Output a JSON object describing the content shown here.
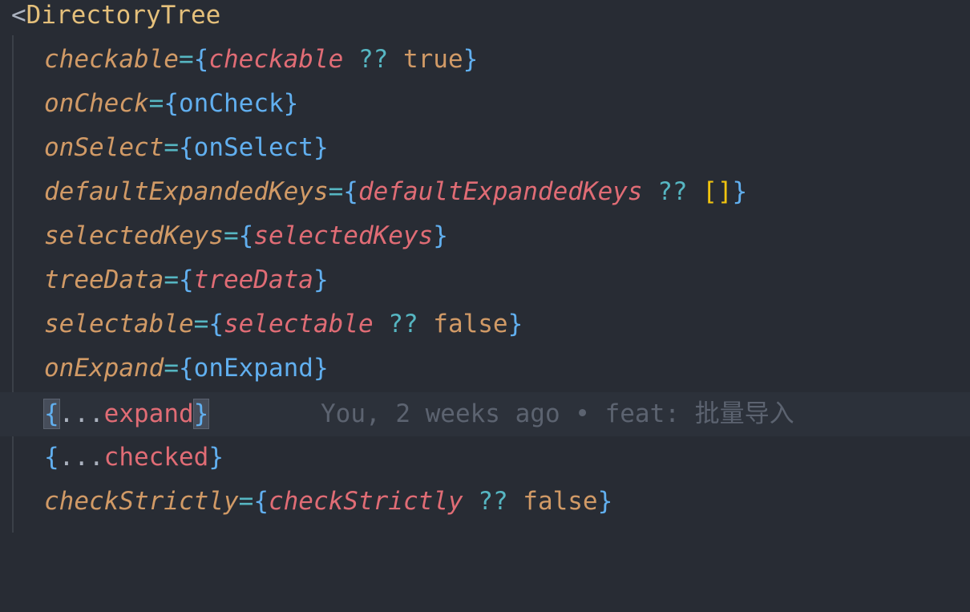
{
  "editor": {
    "lines": {
      "l0": {
        "open": "<",
        "tag": "DirectoryTree"
      },
      "l1": {
        "attr": "checkable",
        "eq": "=",
        "lb": "{",
        "expr": "checkable",
        "op": " ?? ",
        "fallback": "true",
        "rb": "}"
      },
      "l2": {
        "attr": "onCheck",
        "eq": "=",
        "lb": "{",
        "expr": "onCheck",
        "rb": "}"
      },
      "l3": {
        "attr": "onSelect",
        "eq": "=",
        "lb": "{",
        "expr": "onSelect",
        "rb": "}"
      },
      "l4": {
        "attr": "defaultExpandedKeys",
        "eq": "=",
        "lb": "{",
        "expr": "defaultExpandedKeys",
        "op": " ?? ",
        "fallback": "[]",
        "rb": "}"
      },
      "l5": {
        "attr": "selectedKeys",
        "eq": "=",
        "lb": "{",
        "expr": "selectedKeys",
        "rb": "}"
      },
      "l6": {
        "attr": "treeData",
        "eq": "=",
        "lb": "{",
        "expr": "treeData",
        "rb": "}"
      },
      "l7": {
        "attr": "selectable",
        "eq": "=",
        "lb": "{",
        "expr": "selectable",
        "op": " ?? ",
        "fallback": "false",
        "rb": "}"
      },
      "l8": {
        "attr": "onExpand",
        "eq": "=",
        "lb": "{",
        "expr": "onExpand",
        "rb": "}"
      },
      "l9": {
        "lb": "{",
        "spread": "...",
        "expr": "expand",
        "rb": "}"
      },
      "l10": {
        "lb": "{",
        "spread": "...",
        "expr": "checked",
        "rb": "}"
      },
      "l11": {
        "attr": "checkStrictly",
        "eq": "=",
        "lb": "{",
        "expr": "checkStrictly",
        "op": " ?? ",
        "fallback": "false",
        "rb": "}"
      }
    },
    "blame": "You, 2 weeks ago • feat: 批量导入"
  },
  "colors": {
    "background": "#282c34",
    "current_line": "#2c313a",
    "tag": "#e5c07b",
    "attribute": "#d19a66",
    "variable": "#e06c75",
    "function": "#61afef",
    "operator": "#56b6c2",
    "bracket_highlight": "#f1c40f",
    "blame_text": "#5c6370"
  }
}
